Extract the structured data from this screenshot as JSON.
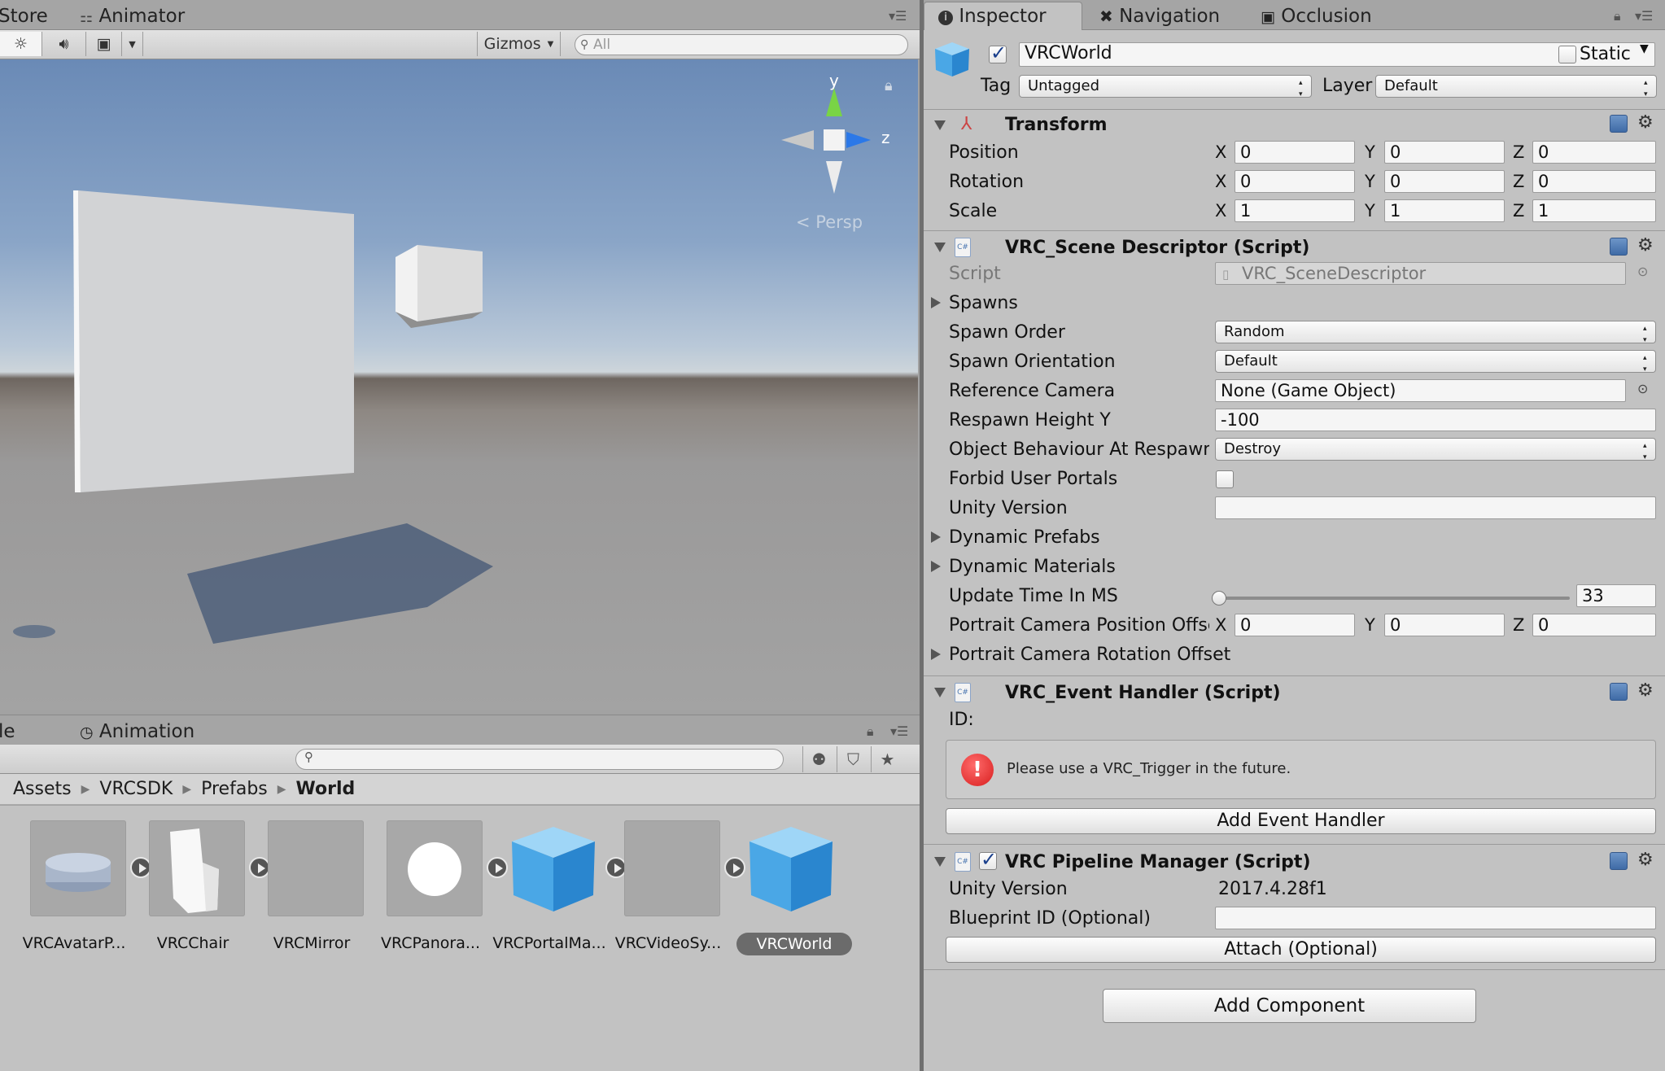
{
  "scene_tabs": {
    "store": "Store",
    "animator": "Animator"
  },
  "scene_toolbar": {
    "gizmos": "Gizmos",
    "search_placeholder": "All"
  },
  "viewport": {
    "axis_y": "y",
    "axis_z": "z",
    "projection": "Persp"
  },
  "project_tabs": {
    "project_partial": "le",
    "animation": "Animation"
  },
  "breadcrumb": [
    "Assets",
    "VRCSDK",
    "Prefabs",
    "World"
  ],
  "assets": [
    {
      "label": "VRCAvatarP...",
      "play": true
    },
    {
      "label": "VRCChair",
      "play": true
    },
    {
      "label": "VRCMirror",
      "play": false
    },
    {
      "label": "VRCPanora...",
      "play": true
    },
    {
      "label": "VRCPortalMa...",
      "play": true
    },
    {
      "label": "VRCVideoSy...",
      "play": true
    },
    {
      "label": "VRCWorld",
      "play": false,
      "selected": true
    }
  ],
  "inspector_tabs": {
    "inspector": "Inspector",
    "navigation": "Navigation",
    "occlusion": "Occlusion"
  },
  "object": {
    "name": "VRCWorld",
    "active": true,
    "static_label": "Static",
    "static": false,
    "tag_label": "Tag",
    "tag": "Untagged",
    "layer_label": "Layer",
    "layer": "Default"
  },
  "transform": {
    "title": "Transform",
    "rows": [
      {
        "label": "Position",
        "x": "0",
        "y": "0",
        "z": "0"
      },
      {
        "label": "Rotation",
        "x": "0",
        "y": "0",
        "z": "0"
      },
      {
        "label": "Scale",
        "x": "1",
        "y": "1",
        "z": "1"
      }
    ],
    "axis": {
      "x": "X",
      "y": "Y",
      "z": "Z"
    }
  },
  "scene_descriptor": {
    "title": "VRC_Scene Descriptor (Script)",
    "script_label": "Script",
    "script_value": "VRC_SceneDescriptor",
    "spawns": "Spawns",
    "spawn_order_label": "Spawn Order",
    "spawn_order": "Random",
    "spawn_orientation_label": "Spawn Orientation",
    "spawn_orientation": "Default",
    "reference_camera_label": "Reference Camera",
    "reference_camera": "None (Game Object)",
    "respawn_height_label": "Respawn Height Y",
    "respawn_height": "-100",
    "object_behaviour_label": "Object Behaviour At Respawn H",
    "object_behaviour": "Destroy",
    "forbid_portals_label": "Forbid User Portals",
    "forbid_portals": false,
    "unity_version_label": "Unity Version",
    "unity_version": "",
    "dynamic_prefabs": "Dynamic Prefabs",
    "dynamic_materials": "Dynamic Materials",
    "update_time_label": "Update Time In MS",
    "update_time": "33",
    "update_time_slider_fraction": 0.0,
    "portrait_pos_label": "Portrait Camera Position Offset",
    "portrait_pos": {
      "x": "0",
      "y": "0",
      "z": "0"
    },
    "portrait_rot_label": "Portrait Camera Rotation Offset"
  },
  "event_handler": {
    "title": "VRC_Event Handler (Script)",
    "id_label": "ID:",
    "warning": "Please use a VRC_Trigger in the future.",
    "add_button": "Add Event Handler"
  },
  "pipeline_manager": {
    "title": "VRC Pipeline Manager (Script)",
    "enabled": true,
    "unity_version_label": "Unity Version",
    "unity_version": "2017.4.28f1",
    "blueprint_label": "Blueprint ID (Optional)",
    "blueprint_id": "",
    "attach_button": "Attach (Optional)"
  },
  "add_component": "Add Component",
  "colors": {
    "accent": "#3f6ba6",
    "selection": "#6b6b6b",
    "error": "#d81e1e"
  }
}
